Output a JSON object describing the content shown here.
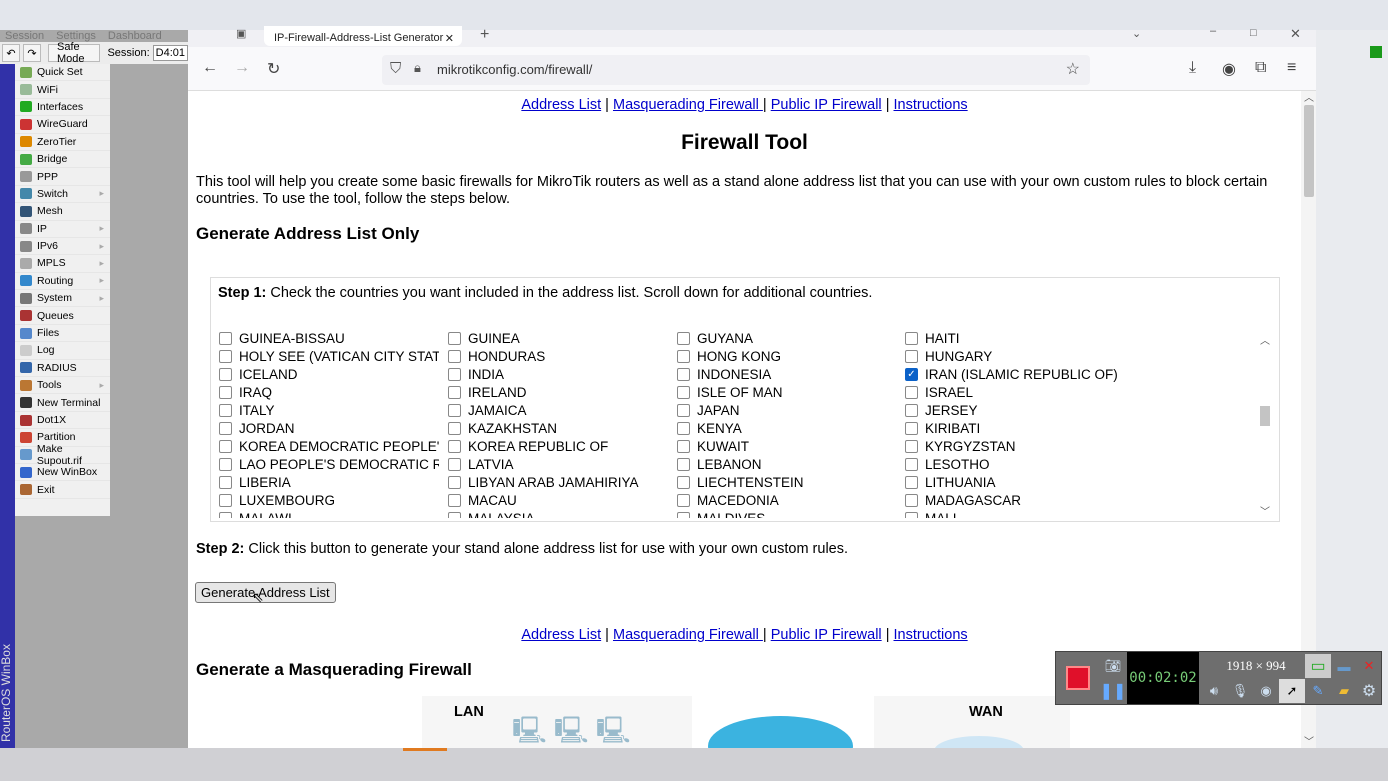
{
  "winbox": {
    "menu": [
      "Session",
      "Settings",
      "Dashboard"
    ],
    "safe_mode": "Safe Mode",
    "session_label": "Session:",
    "session_value": "D4:01",
    "vertical_title": "RouterOS WinBox",
    "items": [
      {
        "label": "Quick Set",
        "color": "#7a5"
      },
      {
        "label": "WiFi",
        "color": "#9b9"
      },
      {
        "label": "Interfaces",
        "color": "#2a2"
      },
      {
        "label": "WireGuard",
        "color": "#c33"
      },
      {
        "label": "ZeroTier",
        "color": "#d80"
      },
      {
        "label": "Bridge",
        "color": "#4a4"
      },
      {
        "label": "PPP",
        "color": "#999"
      },
      {
        "label": "Switch",
        "color": "#48a",
        "sub": true
      },
      {
        "label": "Mesh",
        "color": "#357"
      },
      {
        "label": "IP",
        "color": "#888",
        "sub": true
      },
      {
        "label": "IPv6",
        "color": "#888",
        "sub": true
      },
      {
        "label": "MPLS",
        "color": "#aaa",
        "sub": true
      },
      {
        "label": "Routing",
        "color": "#38c",
        "sub": true
      },
      {
        "label": "System",
        "color": "#777",
        "sub": true
      },
      {
        "label": "Queues",
        "color": "#a33"
      },
      {
        "label": "Files",
        "color": "#58c"
      },
      {
        "label": "Log",
        "color": "#ccc"
      },
      {
        "label": "RADIUS",
        "color": "#36a"
      },
      {
        "label": "Tools",
        "color": "#b73",
        "sub": true
      },
      {
        "label": "New Terminal",
        "color": "#333"
      },
      {
        "label": "Dot1X",
        "color": "#a33"
      },
      {
        "label": "Partition",
        "color": "#c43"
      },
      {
        "label": "Make Supout.rif",
        "color": "#69c"
      },
      {
        "label": "New WinBox",
        "color": "#36c"
      },
      {
        "label": "Exit",
        "color": "#a63"
      }
    ]
  },
  "browser": {
    "tab_title": "IP-Firewall-Address-List Generator",
    "url": "mikrotikconfig.com/firewall/"
  },
  "page": {
    "links": [
      "Address List",
      "Masquerading Firewall ",
      "Public IP Firewall",
      "Instructions"
    ],
    "sep": "|",
    "title": "Firewall Tool",
    "intro": "This tool will help you create some basic firewalls for MikroTik routers as well as a stand alone address list that you can use with your own custom rules to block certain countries. To use the tool, follow the steps below.",
    "section1": "Generate Address List Only",
    "step1_label": "Step 1:",
    "step1_text": " Check the countries you want included in the address list. Scroll down for additional countries.",
    "countries": [
      [
        "GUINEA-BISSAU",
        "GUINEA",
        "GUYANA",
        "HAITI"
      ],
      [
        "HOLY SEE (VATICAN CITY STATE)",
        "HONDURAS",
        "HONG KONG",
        "HUNGARY"
      ],
      [
        "ICELAND",
        "INDIA",
        "INDONESIA",
        "IRAN (ISLAMIC REPUBLIC OF)"
      ],
      [
        "IRAQ",
        "IRELAND",
        "ISLE OF MAN",
        "ISRAEL"
      ],
      [
        "ITALY",
        "JAMAICA",
        "JAPAN",
        "JERSEY"
      ],
      [
        "JORDAN",
        "KAZAKHSTAN",
        "KENYA",
        "KIRIBATI"
      ],
      [
        "KOREA DEMOCRATIC PEOPLE'S REPUBLIC",
        "KOREA REPUBLIC OF",
        "KUWAIT",
        "KYRGYZSTAN"
      ],
      [
        "LAO PEOPLE'S DEMOCRATIC REPUBLIC",
        "LATVIA",
        "LEBANON",
        "LESOTHO"
      ],
      [
        "LIBERIA",
        "LIBYAN ARAB JAMAHIRIYA",
        "LIECHTENSTEIN",
        "LITHUANIA"
      ],
      [
        "LUXEMBOURG",
        "MACAU",
        "MACEDONIA",
        "MADAGASCAR"
      ],
      [
        "MALAWI",
        "MALAYSIA",
        "MALDIVES",
        "MALI"
      ]
    ],
    "checked": [
      "IRAN (ISLAMIC REPUBLIC OF)"
    ],
    "step2_label": "Step 2:",
    "step2_text": " Click this button to generate your stand alone address list for use with your own custom rules.",
    "generate_button": "Generate Address List",
    "section2": "Generate a Masquerading Firewall",
    "diagram_lan": "LAN",
    "diagram_wan": "WAN"
  },
  "recorder": {
    "timer": "00:02:02",
    "resolution": "1918 × 994"
  }
}
